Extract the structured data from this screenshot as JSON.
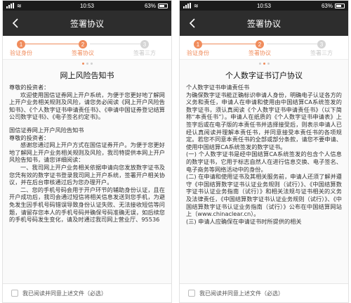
{
  "statusbar": {
    "time": "10:53",
    "battery": "63%"
  },
  "navbar": {
    "title": "签署协议"
  },
  "steps": [
    {
      "num": "1",
      "label": "验证身份",
      "state": "done"
    },
    {
      "num": "2",
      "label": "签署协议",
      "state": "active"
    },
    {
      "num": "3",
      "label": "签署三方",
      "state": "todo"
    }
  ],
  "left_doc": {
    "title": "网上风险告知书",
    "paragraphs": [
      "尊敬的投资者：",
      "欢迎使用国信证券网上开户系统，为便于您更好地了解网上开户业务相关规则及风险，请您务必阅读《网上开户风险告知书》、《个人数字证书申请责任书》、《申请中国证券登记结算公司数字证书》、《电子签名约定书》。",
      "国信证券网上开户风险告知书",
      "尊敬的投资者：",
      "感谢您通过网上开户方式在国信证券开户。为便于您更好地了解网上开户业务相关规则及风险，我司特提供本网上开户风险告知书，请您详细阅读：",
      "一、我司网上开户业务相关依据申请向您发放数字证书及您凭有效的数字证书登录我司网上开户系统，签署开户相关协议，并在后台审核通过后为您办理开户。",
      "二、您的手机号码会用于开户环节的辅助身份认证，且在开户成功后，我司会通过短信将相关信息发送到您手机，为避免发生因手机号码错误导致身份认证失败、无法接收短信等问题，请留存您本人的手机号码并确保号码准确无误，如后续您的手机号码发生变化，请及时通过我司网上营业厅、95536"
    ]
  },
  "right_doc": {
    "title": "个人数字证书订户协议",
    "paragraphs": [
      "个人数字证书申请责任书",
      "为确保数字证书能正确标识申请人身份，明确电子认证各方的义务和责任，申请人在申请和使用由中国结算CA系统签发的数字证书，须认真阅读《个人数字证书申请责任书》（以下简称“本责任书”）。申请人在纸质的《个人数字证书申请表》上签字后或在电子版的本责任书并选择接受后，则表示申请人已经认真阅读并理解本责任书，并同意接受本责任书的各项规定。若您不同意本责任书的全部或部分条款，请您不要申请、使用中国结算CA系统签发的数字证书。",
      "(一) 个人数字证书是经中国结算CA系统签发的包含个人信息的数字证书，它用于标志自然人在进行信息交换、电子签名、电子商务等网络活动中的身份。",
      "(二) 在申请和使用证书及其相关服务前，申请人还须了解并遵守《中国结算数字证书认证业务规则（试行）》、《中国结算数字证书认证业务指南（试行）》和相关法规与证书相关的义务及法律责任，《中国结算数字证书认证业务规则（试行）》、《中国结算数字证书认证业务指南（试行）》公布在中国结算网站上（www.chinaclear.cn）。",
      "(三) 申请人应确保在申请证书时所提供的相关"
    ]
  },
  "agree": {
    "label": "我已阅读并同意上述文件（必选）"
  },
  "colors": {
    "accent": "#f08c5c",
    "navbar": "#2d2d2d",
    "statusbar": "#1b1b1b"
  }
}
